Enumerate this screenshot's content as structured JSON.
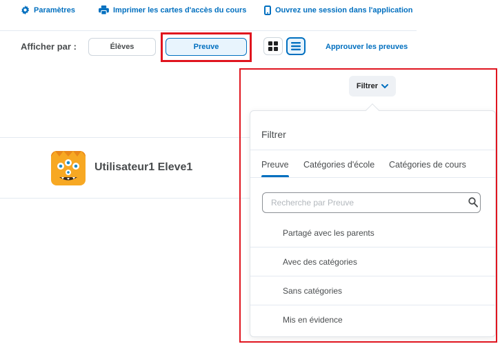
{
  "toolbar": {
    "settings_label": "Paramètres",
    "print_label": "Imprimer les cartes d'accès du cours",
    "session_label": "Ouvrez une session dans l'application"
  },
  "view_by": {
    "label": "Afficher par :",
    "options": [
      "Élèves",
      "Preuve"
    ],
    "selected": "Preuve"
  },
  "approve_label": "Approuver les preuves",
  "filter_button_label": "Filtrer",
  "student": {
    "name": "Utilisateur1 Eleve1"
  },
  "filter_panel": {
    "title": "Filtrer",
    "tabs": [
      "Preuve",
      "Catégories d'école",
      "Catégories de cours"
    ],
    "active_tab": "Preuve",
    "search_placeholder": "Recherche par Preuve",
    "items": [
      "Partagé avec les parents",
      "Avec des catégories",
      "Sans catégories",
      "Mis en évidence"
    ]
  },
  "colors": {
    "accent": "#006fbf",
    "highlight": "#e0141e",
    "avatar": "#f7a823",
    "text": "#494c4e"
  }
}
